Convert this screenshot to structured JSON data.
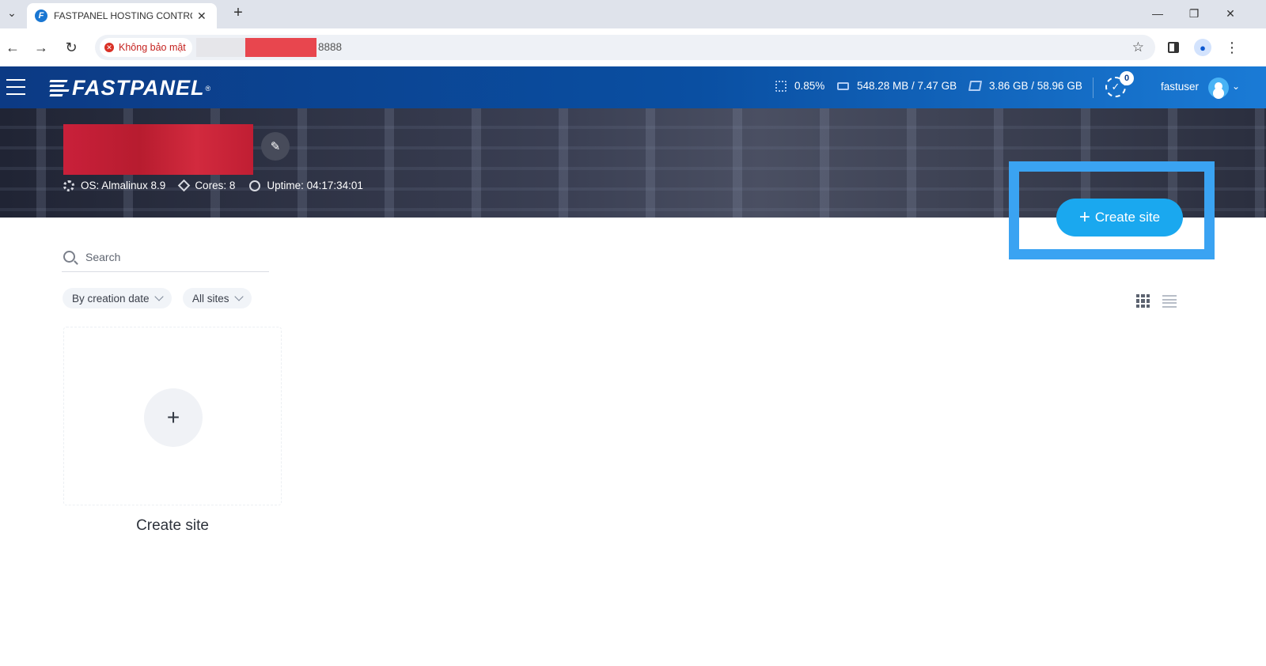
{
  "browser": {
    "tab_title": "FASTPANEL HOSTING CONTROL",
    "tab_favicon": "F",
    "security_label": "Không bảo mật",
    "url_suffix": "8888"
  },
  "header": {
    "logo_text": "FASTPANEL",
    "logo_reg": "®",
    "cpu": "0.85%",
    "ram": "548.28 MB / 7.47 GB",
    "disk": "3.86 GB / 58.96 GB",
    "tasks_count": "0",
    "username": "fastuser"
  },
  "server": {
    "os": "OS: Almalinux 8.9",
    "cores": "Cores: 8",
    "uptime": "Uptime: 04:17:34:01"
  },
  "actions": {
    "create_site_label": "Create site"
  },
  "filters": {
    "search_placeholder": "Search",
    "sort_label": "By creation date",
    "scope_label": "All sites"
  },
  "card": {
    "plus": "+",
    "label": "Create site"
  },
  "colors": {
    "accent": "#1aa8ef",
    "highlight": "#3aa3f2",
    "header_start": "#0c3a84",
    "header_end": "#1a7bd6"
  }
}
